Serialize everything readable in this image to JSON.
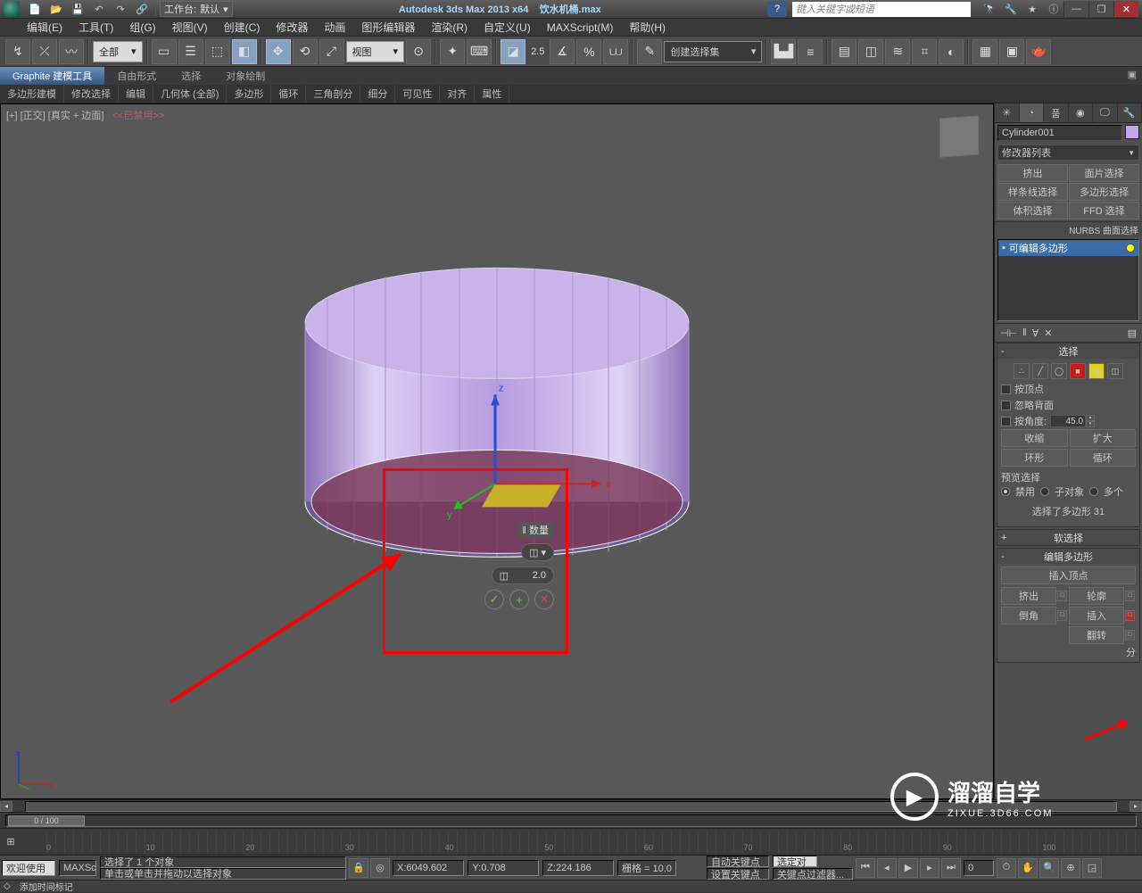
{
  "title": {
    "app": "Autodesk 3ds Max  2013 x64",
    "file": "饮水机桶.max"
  },
  "workspace": {
    "label": "工作台:",
    "value": "默认"
  },
  "search_placeholder": "键入关键字或短语",
  "win": {
    "min": "—",
    "max": "❐",
    "close": "✕"
  },
  "menu": [
    "编辑(E)",
    "工具(T)",
    "组(G)",
    "视图(V)",
    "创建(C)",
    "修改器",
    "动画",
    "图形编辑器",
    "渲染(R)",
    "自定义(U)",
    "MAXScript(M)",
    "帮助(H)"
  ],
  "toolbar": {
    "all": "全部",
    "view": "视图",
    "angle": "2.5",
    "named_sel": "创建选择集"
  },
  "ribbon_tabs": [
    "Graphite 建模工具",
    "自由形式",
    "选择",
    "对象绘制"
  ],
  "ribbon_groups": [
    "多边形建模",
    "修改选择",
    "编辑",
    "几何体 (全部)",
    "多边形",
    "循环",
    "三角剖分",
    "细分",
    "可见性",
    "对齐",
    "属性"
  ],
  "viewport_label": {
    "a": "[+]",
    "b": "[正交]",
    "c": "[真实 + 边面]",
    "d": "<<已禁用>>"
  },
  "caddy": {
    "title": "‖ 数量",
    "value": "2.0"
  },
  "axes": {
    "x": "x",
    "y": "y",
    "z": "z"
  },
  "cmd": {
    "name": "Cylinder001",
    "mod_list_label": "修改器列表",
    "presets": [
      [
        "挤出",
        "面片选择"
      ],
      [
        "样条线选择",
        "多边形选择"
      ],
      [
        "体积选择",
        "FFD 选择"
      ]
    ],
    "nurbs": "NURBS 曲面选择",
    "stack_item": "可编辑多边形"
  },
  "roll_select": {
    "title": "选择",
    "by_vertex": "按顶点",
    "ignore_back": "忽略背面",
    "by_angle": "按角度:",
    "angle_val": "45.0",
    "shrink": "收缩",
    "grow": "扩大",
    "ring": "环形",
    "loop": "循环",
    "preview": "预览选择",
    "opts": [
      "禁用",
      "子对象",
      "多个"
    ],
    "status": "选择了多边形 31"
  },
  "roll_soft": {
    "title": "软选择"
  },
  "roll_edit": {
    "title": "编辑多边形",
    "insert_vert": "插入顶点",
    "rows": [
      [
        "挤出",
        "轮廓"
      ],
      [
        "倒角",
        "插入"
      ]
    ],
    "flip": "翻转",
    "last": "分"
  },
  "timeline": {
    "frame": "0 / 100"
  },
  "ticks": [
    "0",
    "10",
    "20",
    "30",
    "40",
    "50",
    "60",
    "70",
    "80",
    "90",
    "100"
  ],
  "status": {
    "welcome": "欢迎使用",
    "maxscr": "MAXSc",
    "sel": "选择了 1 个对象",
    "hint": "单击或单击并拖动以选择对象",
    "x": "X:",
    "xv": "6049.602",
    "y": "Y:",
    "yv": "0.708",
    "z": "Z:",
    "zv": "224.186",
    "grid": "栅格 = 10.0",
    "addtime": "添加时间标记",
    "autokey": "自动关键点",
    "setkey": "设置关键点",
    "selset": "选定对",
    "keyfilter": "关键点过滤器..."
  },
  "watermark": {
    "brand": "溜溜自学",
    "url": "ZIXUE.3D66.COM"
  }
}
